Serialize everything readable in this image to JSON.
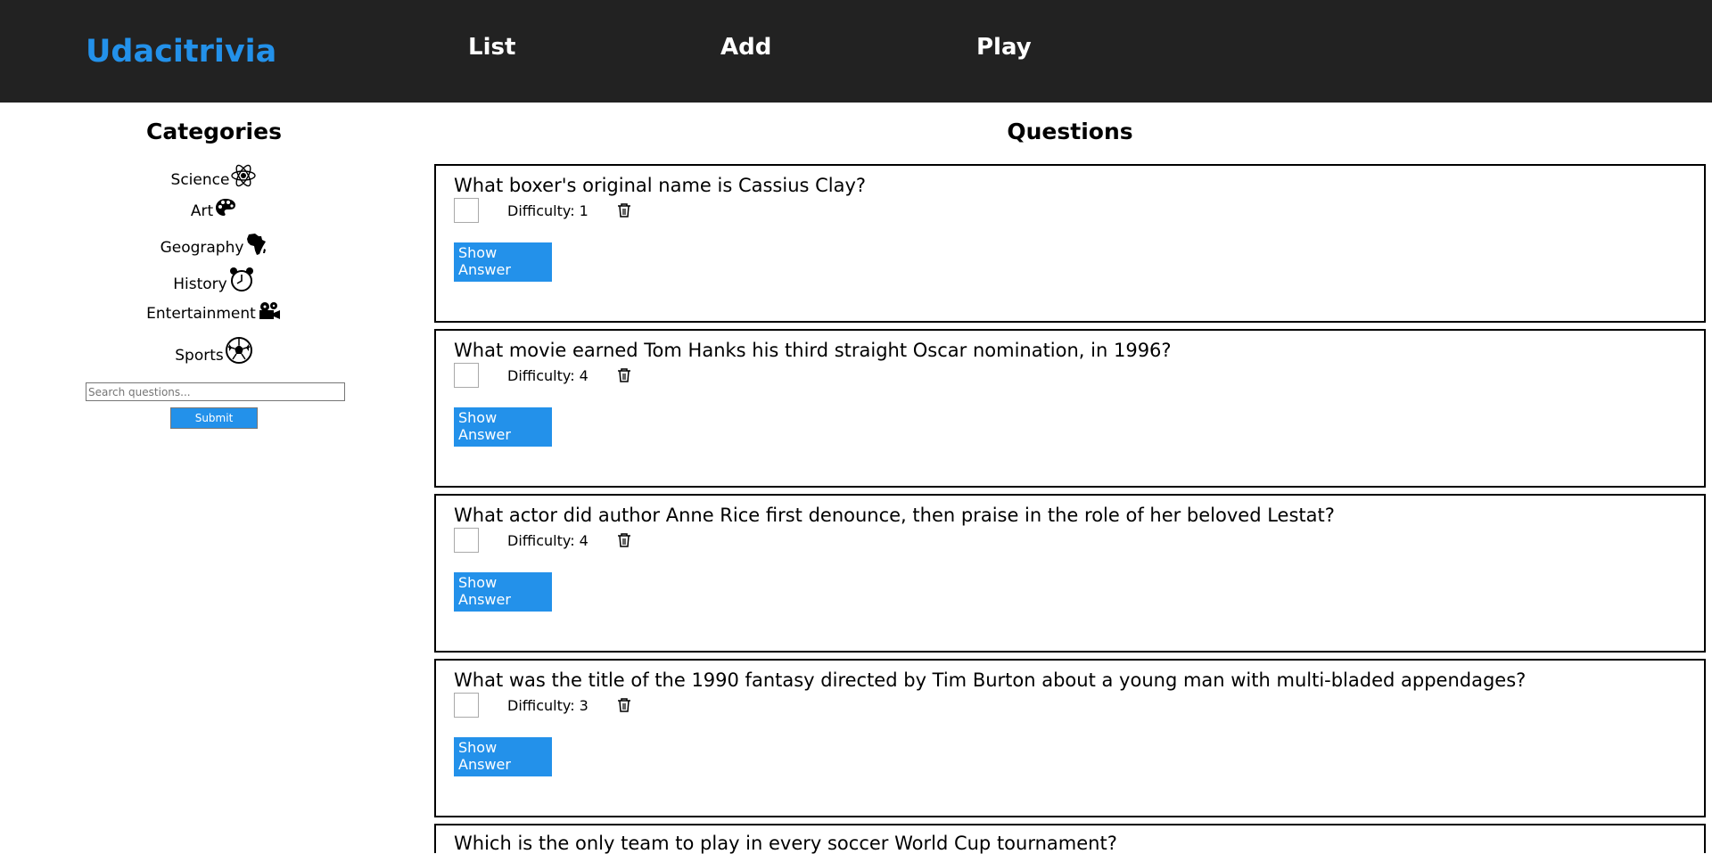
{
  "header": {
    "brand": "Udacitrivia",
    "nav": [
      "List",
      "Add",
      "Play"
    ],
    "colors": {
      "bar": "#222222",
      "brand": "#2391ea",
      "link": "#ffffff"
    }
  },
  "sidebar": {
    "title": "Categories",
    "categories": [
      {
        "label": "Science",
        "icon": "atom-icon"
      },
      {
        "label": "Art",
        "icon": "palette-icon"
      },
      {
        "label": "Geography",
        "icon": "africa-icon"
      },
      {
        "label": "History",
        "icon": "alarm-clock-icon"
      },
      {
        "label": "Entertainment",
        "icon": "film-camera-icon"
      },
      {
        "label": "Sports",
        "icon": "soccer-ball-icon"
      }
    ],
    "search": {
      "placeholder": "Search questions...",
      "value": ""
    },
    "submit_label": "Submit"
  },
  "main": {
    "title": "Questions",
    "difficulty_prefix": "Difficulty: ",
    "show_answer_label": "Show Answer",
    "questions": [
      {
        "question": "What boxer's original name is Cassius Clay?",
        "difficulty": "1"
      },
      {
        "question": "What movie earned Tom Hanks his third straight Oscar nomination, in 1996?",
        "difficulty": "4"
      },
      {
        "question": "What actor did author Anne Rice first denounce, then praise in the role of her beloved Lestat?",
        "difficulty": "4"
      },
      {
        "question": "What was the title of the 1990 fantasy directed by Tim Burton about a young man with multi-bladed appendages?",
        "difficulty": "3"
      },
      {
        "question": "Which is the only team to play in every soccer World Cup tournament?",
        "difficulty": ""
      }
    ]
  },
  "colors": {
    "accent": "#2391ea",
    "card_border": "#000000"
  }
}
